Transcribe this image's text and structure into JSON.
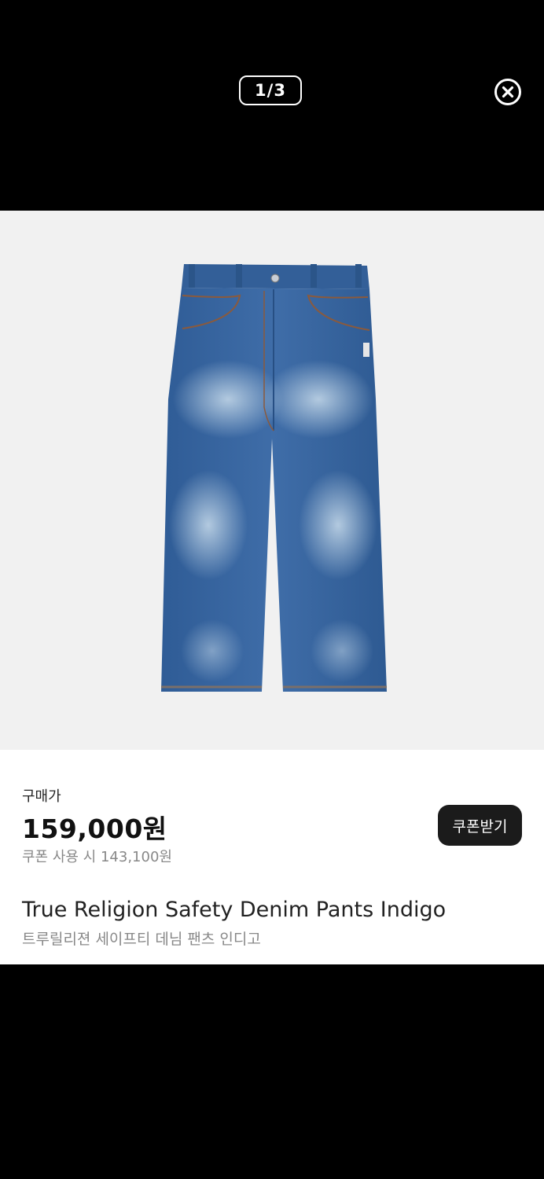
{
  "viewer": {
    "pager": "1/3",
    "close_icon": "close-circle-icon"
  },
  "product": {
    "image_icon": "jeans-photo",
    "price_label": "구매가",
    "price": "159,000원",
    "coupon_price": "쿠폰 사용 시 143,100원",
    "coupon_button_label": "쿠폰받기",
    "title_en": "True Religion Safety Denim Pants Indigo",
    "title_ko": "트루릴리젼 세이프티 데님 팬츠 인디고"
  },
  "colors": {
    "denim": "#3b68a3",
    "denim_light": "#9dbad6",
    "button_bg": "#1b1b1b",
    "image_bg": "#f1f1f1"
  }
}
